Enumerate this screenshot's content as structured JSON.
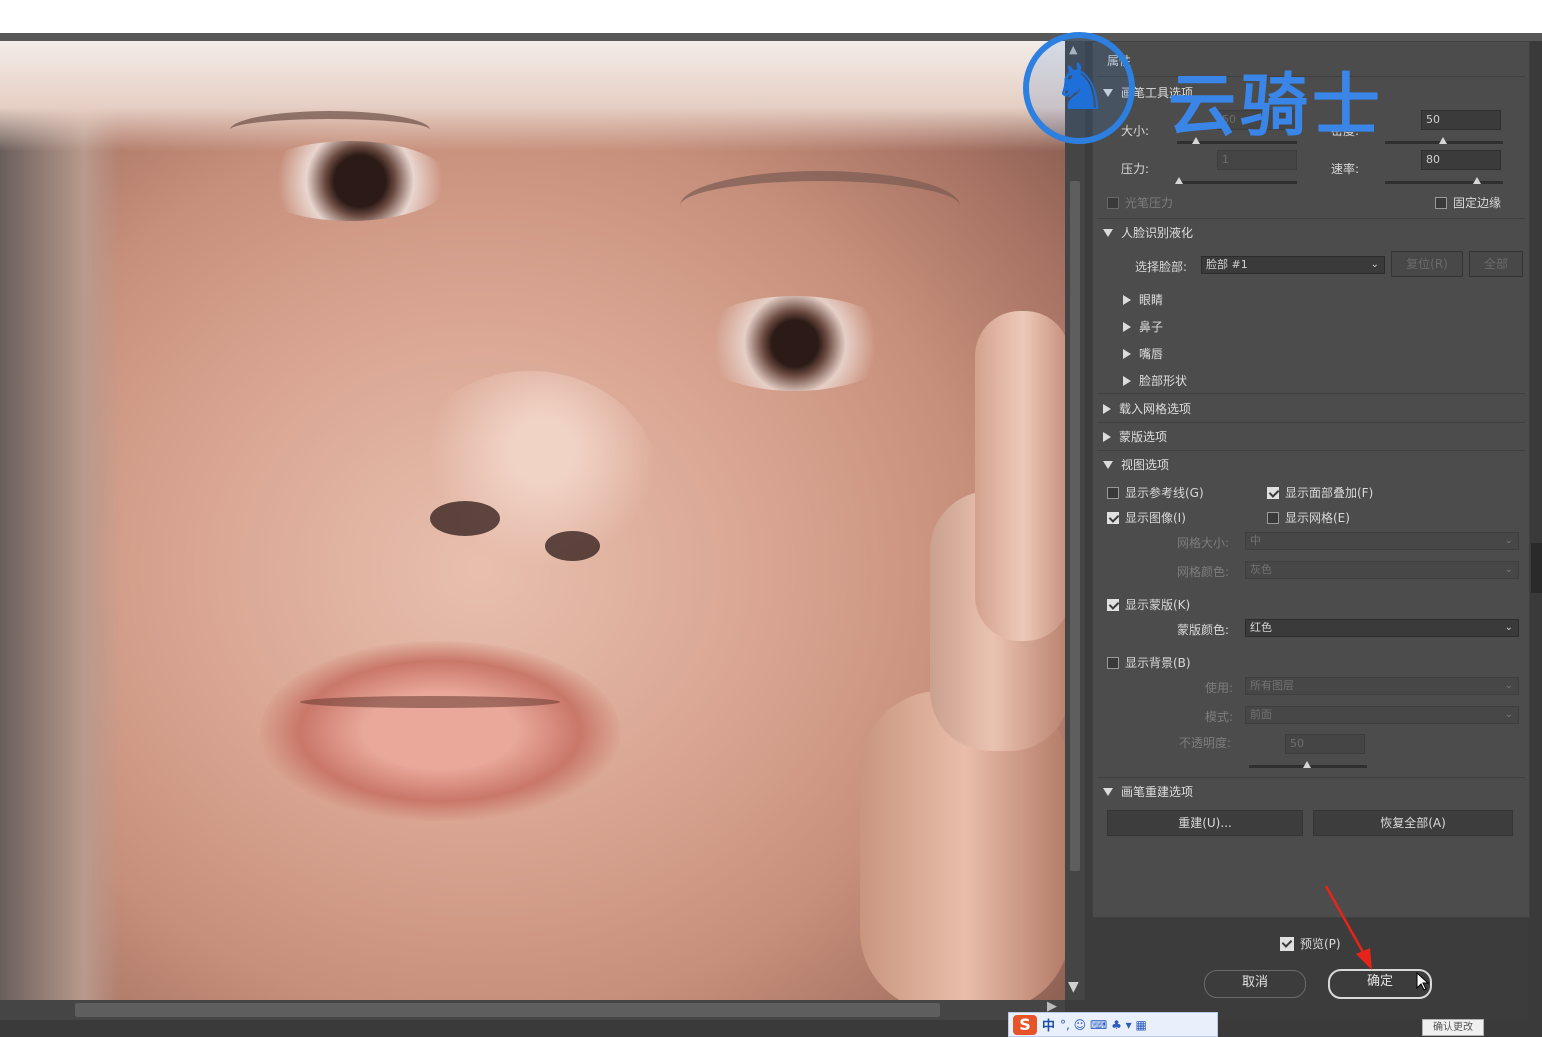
{
  "watermark": {
    "text": "云骑士",
    "icon": "knight-horse-logo-icon"
  },
  "panel": {
    "header_label": "属性",
    "tool_section": "画笔工具选项",
    "size_label": "大小:",
    "size_value": "50",
    "density_label": "密度:",
    "density_value": "50",
    "pressure_label": "压力:",
    "pressure_value": "1",
    "rate_label": "速率:",
    "rate_value": "80",
    "stylus_pressure": "光笔压力",
    "pin_edges": "固定边缘",
    "face_section": "人脸识别液化",
    "select_face_label": "选择脸部:",
    "select_face_value": "脸部 #1",
    "reset_button": "复位(R)",
    "all_button": "全部",
    "face_items": [
      "眼睛",
      "鼻子",
      "嘴唇",
      "脸部形状"
    ],
    "load_mesh": "载入网格选项",
    "mask_options": "蒙版选项",
    "view_options": "视图选项",
    "show_guides": "显示参考线(G)",
    "show_face_overlay": "显示面部叠加(F)",
    "show_image": "显示图像(I)",
    "show_mesh": "显示网格(E)",
    "mesh_size_label": "网格大小:",
    "mesh_size_value": "中",
    "mesh_color_label": "网格颜色:",
    "mesh_color_value": "灰色",
    "show_mask": "显示蒙版(K)",
    "mask_color_label": "蒙版颜色:",
    "mask_color_value": "红色",
    "show_backdrop": "显示背景(B)",
    "use_label": "使用:",
    "use_value": "所有图层",
    "mode_label": "模式:",
    "mode_value": "前面",
    "opacity_label": "不透明度:",
    "opacity_value": "50",
    "brush_reconstruct": "画笔重建选项",
    "reconstruct_button": "重建(U)...",
    "restore_all_button": "恢复全部(A)"
  },
  "dialog": {
    "preview_label": "预览(P)",
    "cancel_label": "取消",
    "ok_label": "确定"
  },
  "taskbar": {
    "ime_logo": "S",
    "ime_lang": "中",
    "ime_glyphs": "°, ☺ ⌨ ♣ ▾ ▦",
    "tooltip": "确认更改"
  }
}
